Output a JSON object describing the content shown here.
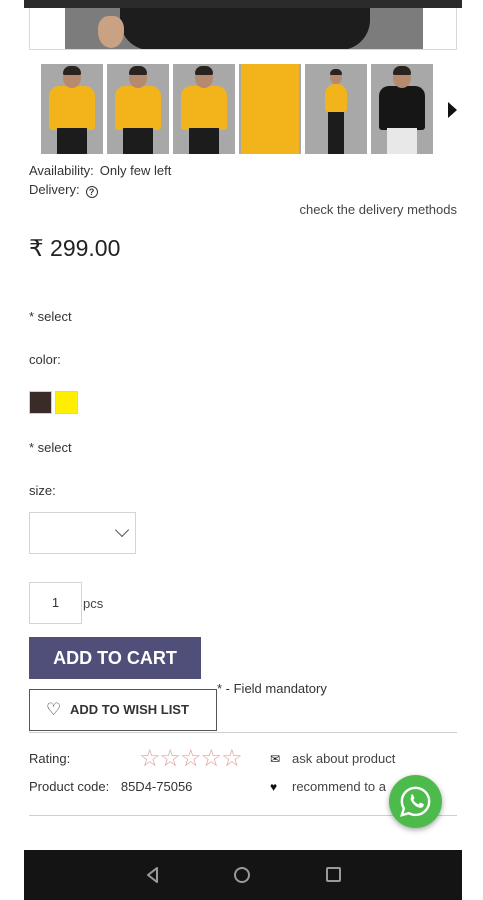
{
  "gallery": {
    "thumbnails": [
      {
        "alt": "yellow tee front"
      },
      {
        "alt": "yellow tee back"
      },
      {
        "alt": "yellow tee side"
      },
      {
        "alt": "yellow tee closeup"
      },
      {
        "alt": "yellow tee full body"
      },
      {
        "alt": "black tee front"
      }
    ]
  },
  "availability": {
    "label": "Availability:",
    "value": "Only few left"
  },
  "delivery": {
    "label": "Delivery:",
    "help_icon": "?",
    "link": "check the delivery methods"
  },
  "price": "₹ 299.00",
  "color_section": {
    "required": "* select",
    "label": "color:",
    "swatches": [
      "#3a2a28",
      "#ffee00"
    ]
  },
  "size_section": {
    "required": "* select",
    "label": "size:",
    "selected": ""
  },
  "quantity": {
    "value": "1",
    "unit": "pcs"
  },
  "buttons": {
    "add_to_cart": "ADD TO CART",
    "wish_list": "ADD TO WISH LIST"
  },
  "mandatory_note": "* - Field mandatory",
  "details": {
    "rating_label": "Rating:",
    "rating_stars": "☆☆☆☆☆",
    "product_code_label": "Product code:",
    "product_code": "85D4-75056",
    "ask_link": "ask about product",
    "recommend_link": "recommend to a"
  },
  "colors": {
    "accent_button": "#4f4f7a",
    "whatsapp": "#4cbb4b",
    "star": "#e2a19c"
  }
}
